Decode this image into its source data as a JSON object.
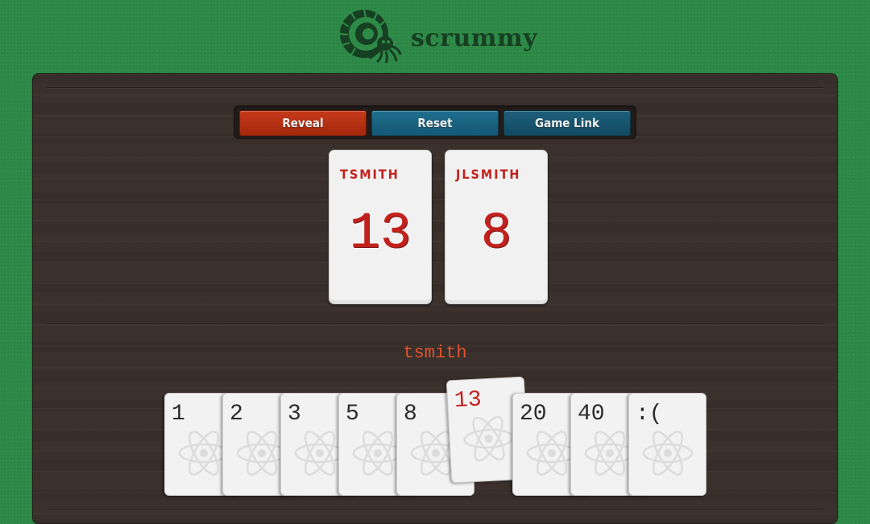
{
  "brand": {
    "name": "scrummy"
  },
  "controls": {
    "reveal": "Reveal",
    "reset": "Reset",
    "game_link": "Game Link"
  },
  "players": [
    {
      "name": "TSMITH",
      "vote": "13"
    },
    {
      "name": "JLSMITH",
      "vote": "8"
    }
  ],
  "current_user": "tsmith",
  "deck": {
    "cards": [
      "1",
      "2",
      "3",
      "5",
      "8",
      "13",
      "20",
      "40",
      ":("
    ],
    "selected": "13"
  },
  "colors": {
    "felt": "#2d8a47",
    "table": "#3a302c",
    "accent_red": "#c3211d",
    "reveal": "#b3300f",
    "blue": "#176585"
  }
}
